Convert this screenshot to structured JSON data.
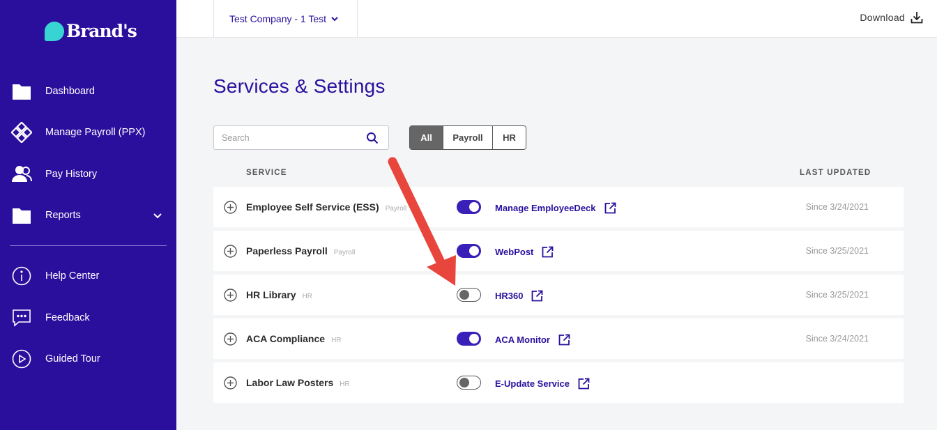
{
  "brand": {
    "name": "Brand's"
  },
  "sidebar": {
    "items": [
      {
        "label": "Dashboard",
        "icon": "folder-icon"
      },
      {
        "label": "Manage Payroll (PPX)",
        "icon": "payroll-diamond-icon"
      },
      {
        "label": "Pay History",
        "icon": "people-icon"
      },
      {
        "label": "Reports",
        "icon": "folder-icon",
        "expandable": true
      },
      {
        "label": "Help Center",
        "icon": "info-circle-icon"
      },
      {
        "label": "Feedback",
        "icon": "chat-bubble-icon"
      },
      {
        "label": "Guided Tour",
        "icon": "play-circle-icon"
      }
    ]
  },
  "topbar": {
    "company": "Test Company - 1 Test",
    "download_label": "Download"
  },
  "main": {
    "title": "Services & Settings",
    "search_placeholder": "Search",
    "filters": [
      {
        "label": "All",
        "active": true
      },
      {
        "label": "Payroll",
        "active": false
      },
      {
        "label": "HR",
        "active": false
      }
    ],
    "columns": {
      "service": "SERVICE",
      "last_updated": "LAST UPDATED"
    },
    "rows": [
      {
        "name": "Employee Self Service (ESS)",
        "tag": "Payroll",
        "enabled": true,
        "link": "Manage EmployeeDeck",
        "date": "Since 3/24/2021"
      },
      {
        "name": "Paperless Payroll",
        "tag": "Payroll",
        "enabled": true,
        "link": "WebPost",
        "date": "Since 3/25/2021"
      },
      {
        "name": "HR Library",
        "tag": "HR",
        "enabled": false,
        "link": "HR360",
        "date": "Since 3/25/2021"
      },
      {
        "name": "ACA Compliance",
        "tag": "HR",
        "enabled": true,
        "link": "ACA Monitor",
        "date": "Since 3/24/2021"
      },
      {
        "name": "Labor Law Posters",
        "tag": "HR",
        "enabled": false,
        "link": "E-Update Service",
        "date": ""
      }
    ]
  },
  "colors": {
    "sidebar_bg": "#2a0f9d",
    "accent": "#2a0f9d",
    "logo_bubble": "#38d4d4",
    "toggle_on": "#3a1fb8",
    "annotation_arrow": "#e8453c"
  }
}
